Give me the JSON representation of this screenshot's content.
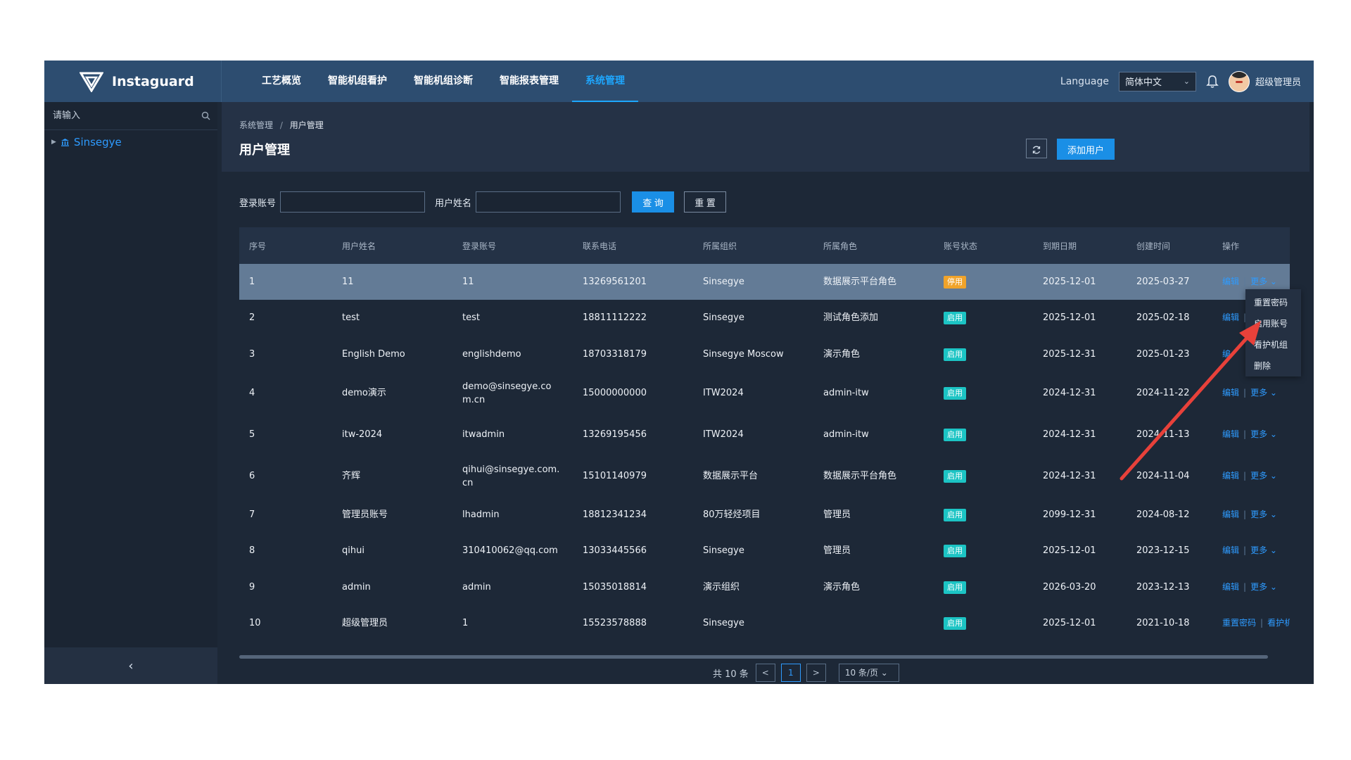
{
  "header": {
    "brand": "Instaguard",
    "nav": [
      "工艺概览",
      "智能机组看护",
      "智能机组诊断",
      "智能报表管理",
      "系统管理"
    ],
    "language_label": "Language",
    "language_value": "简体中文",
    "username": "超级管理员"
  },
  "sidebar": {
    "search_placeholder": "请输入",
    "tree_root": "Sinsegye",
    "collapse_icon": "‹"
  },
  "page": {
    "breadcrumb_parent": "系统管理",
    "breadcrumb_sep": "/",
    "breadcrumb_current": "用户管理",
    "title": "用户管理",
    "add_user_label": "添加用户"
  },
  "filters": {
    "login_label": "登录账号",
    "name_label": "用户姓名",
    "query_label": "查 询",
    "reset_label": "重 置"
  },
  "table": {
    "columns": [
      "序号",
      "用户姓名",
      "登录账号",
      "联系电话",
      "所属组织",
      "所属角色",
      "账号状态",
      "到期日期",
      "创建时间",
      "操作"
    ],
    "rows": [
      {
        "no": "1",
        "name": "11",
        "account": "11",
        "phone": "13269561201",
        "org": "Sinsegye",
        "role": "数据展示平台角色",
        "status": "停用",
        "expire": "2025-12-01",
        "created": "2025-03-27",
        "act1": "编辑",
        "act2": "更多 ⌄"
      },
      {
        "no": "2",
        "name": "test",
        "account": "test",
        "phone": "18811112222",
        "org": "Sinsegye",
        "role": "测试角色添加",
        "status": "启用",
        "expire": "2025-12-01",
        "created": "2025-02-18",
        "act1": "编辑",
        "act2": ""
      },
      {
        "no": "3",
        "name": "English Demo",
        "account": "englishdemo",
        "phone": "18703318179",
        "org": "Sinsegye Moscow",
        "role": "演示角色",
        "status": "启用",
        "expire": "2025-12-31",
        "created": "2025-01-23",
        "act1": "编",
        "act2": ""
      },
      {
        "no": "4",
        "name": "demo演示",
        "account": "demo@sinsegye.com.cn",
        "phone": "15000000000",
        "org": "ITW2024",
        "role": "admin-itw",
        "status": "启用",
        "expire": "2024-12-31",
        "created": "2024-11-22",
        "act1": "编辑",
        "act2": "更多 ⌄"
      },
      {
        "no": "5",
        "name": "itw-2024",
        "account": "itwadmin",
        "phone": "13269195456",
        "org": "ITW2024",
        "role": "admin-itw",
        "status": "启用",
        "expire": "2024-12-31",
        "created": "2024-11-13",
        "act1": "编辑",
        "act2": "更多 ⌄"
      },
      {
        "no": "6",
        "name": "齐辉",
        "account": "qihui@sinsegye.com.cn",
        "phone": "15101140979",
        "org": "数据展示平台",
        "role": "数据展示平台角色",
        "status": "启用",
        "expire": "2024-12-31",
        "created": "2024-11-04",
        "act1": "编辑",
        "act2": "更多 ⌄"
      },
      {
        "no": "7",
        "name": "管理员账号",
        "account": "lhadmin",
        "phone": "18812341234",
        "org": "80万轻烃项目",
        "role": "管理员",
        "status": "启用",
        "expire": "2099-12-31",
        "created": "2024-08-12",
        "act1": "编辑",
        "act2": "更多 ⌄"
      },
      {
        "no": "8",
        "name": "qihui",
        "account": "310410062@qq.com",
        "phone": "13033445566",
        "org": "Sinsegye",
        "role": "管理员",
        "status": "启用",
        "expire": "2025-12-01",
        "created": "2023-12-15",
        "act1": "编辑",
        "act2": "更多 ⌄"
      },
      {
        "no": "9",
        "name": "admin",
        "account": "admin",
        "phone": "15035018814",
        "org": "演示组织",
        "role": "演示角色",
        "status": "启用",
        "expire": "2026-03-20",
        "created": "2023-12-13",
        "act1": "编辑",
        "act2": "更多 ⌄"
      },
      {
        "no": "10",
        "name": "超级管理员",
        "account": "1",
        "phone": "15523578888",
        "org": "Sinsegye",
        "role": "",
        "status": "启用",
        "expire": "2025-12-01",
        "created": "2021-10-18",
        "act1": "重置密码",
        "act2": "看护机"
      }
    ]
  },
  "pagination": {
    "total": "共 10 条",
    "prev": "<",
    "current": "1",
    "next": ">",
    "page_size": "10 条/页 ⌄"
  },
  "dropdown": {
    "items": [
      "重置密码",
      "启用账号",
      "看护机组",
      "删除"
    ]
  },
  "colors": {
    "accent": "#1a8fe6",
    "link": "#2e9bff",
    "status_on": "#1cc4c4",
    "status_off": "#f0a32a",
    "annotation_arrow": "#e8413a"
  }
}
